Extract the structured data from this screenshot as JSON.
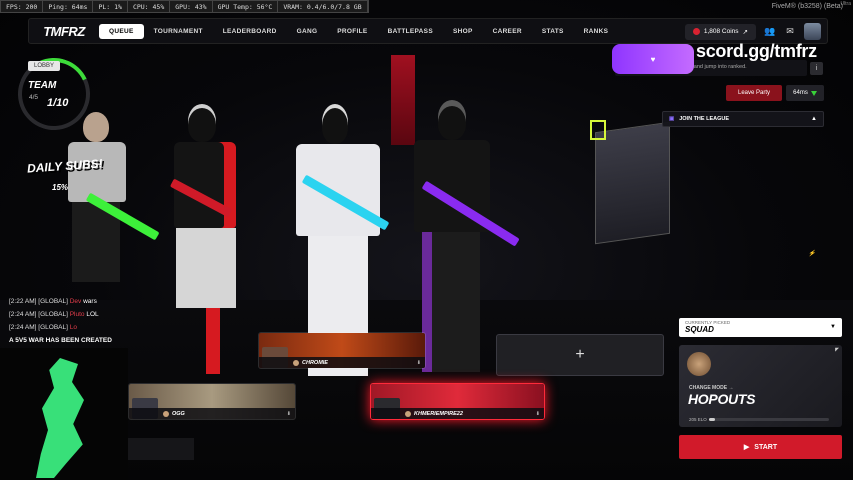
{
  "perf": {
    "fps": "FPS: 200",
    "ping": "Ping: 64ms",
    "pl": "PL: 1%",
    "cpu": "CPU: 45%",
    "gpu": "GPU: 43%",
    "gpu_temp": "GPU Temp: 56°C",
    "vram": "VRAM: 0.4/6.0/7.8 GB"
  },
  "fivem_label": "FiveM® (b3258) (Beta)",
  "fivem_sup": "Ultra",
  "nav": {
    "logo": "TMFRZ",
    "items": [
      "Queue",
      "Tournament",
      "Leaderboard",
      "Gang",
      "Profile",
      "Battlepass",
      "Shop",
      "Career",
      "Stats",
      "Ranks"
    ],
    "coins": "1,808 Coins"
  },
  "lobby": {
    "badge": "LOBBY",
    "team_label": "TEAM",
    "team_count": "4/5",
    "slots": "1/10"
  },
  "overlay": {
    "subs": "DAILY SUBS!",
    "subs_pct": "15%",
    "discord_url": "scord.gg/tmfrz",
    "party_hint": "Set your mode, invite friends, and jump into ranked."
  },
  "party": {
    "leave": "Leave Party",
    "ping": "64ms",
    "league": "JOIN THE LEAGUE"
  },
  "chat": [
    {
      "time": "[2:22 AM]",
      "channel": "[GLOBAL]",
      "name": "Dev",
      "msg": "wars"
    },
    {
      "time": "[2:24 AM]",
      "channel": "[GLOBAL]",
      "name": "Pluto",
      "msg": "LOL"
    },
    {
      "time": "[2:24 AM]",
      "channel": "[GLOBAL]",
      "name": "Lo",
      "msg": ""
    }
  ],
  "chat_banner": "A 5V5 WAR HAS BEEN CREATED",
  "mode": {
    "picked_label": "CURRENTLY PICKED",
    "picked": "SQUAD",
    "change": "CHANGE MODE",
    "name": "HOPOUTS",
    "elo": "205 ELO",
    "elo_progress": 0.05
  },
  "start": "START",
  "players": [
    {
      "name": "CHROMIE"
    },
    {
      "name": "OGG"
    },
    {
      "name": "KHMERIEMPIRE22"
    }
  ],
  "empty_slot": "+",
  "colors": {
    "accent_red": "#d11a2a",
    "ring_green": "#3ddc3a",
    "discord_purple": "#9b45ff"
  }
}
